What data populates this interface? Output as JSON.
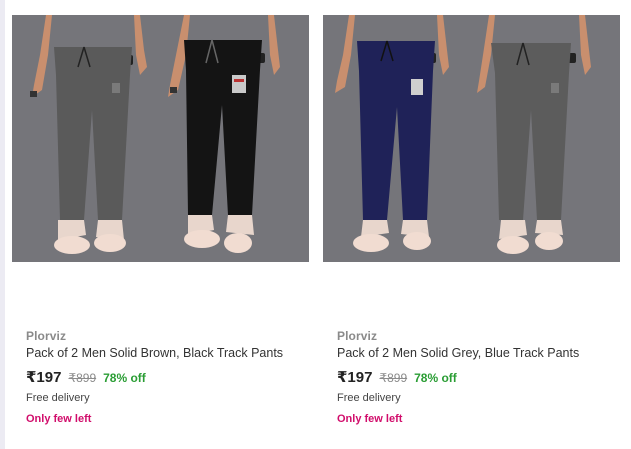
{
  "products": [
    {
      "brand": "Plorviz",
      "title": "Pack of 2 Men Solid Brown, Black Track Pants",
      "price": "₹197",
      "mrp": "₹899",
      "discount": "78% off",
      "delivery": "Free delivery",
      "stock_note": "Only few left",
      "pant_colors": [
        "#5a5a5a",
        "#141414"
      ],
      "shoe_color": "#f1dcd1",
      "bg_color": "#75757a"
    },
    {
      "brand": "Plorviz",
      "title": "Pack of 2 Men Solid Grey, Blue Track Pants",
      "price": "₹197",
      "mrp": "₹899",
      "discount": "78% off",
      "delivery": "Free delivery",
      "stock_note": "Only few left",
      "pant_colors": [
        "#1f2258",
        "#5c5c5c"
      ],
      "shoe_color": "#f1dcd1",
      "bg_color": "#75757a"
    }
  ],
  "colors": {
    "price_discount": "#2a9d34",
    "stock_warning": "#d10d6b",
    "brand_text": "#8a8a8a"
  }
}
